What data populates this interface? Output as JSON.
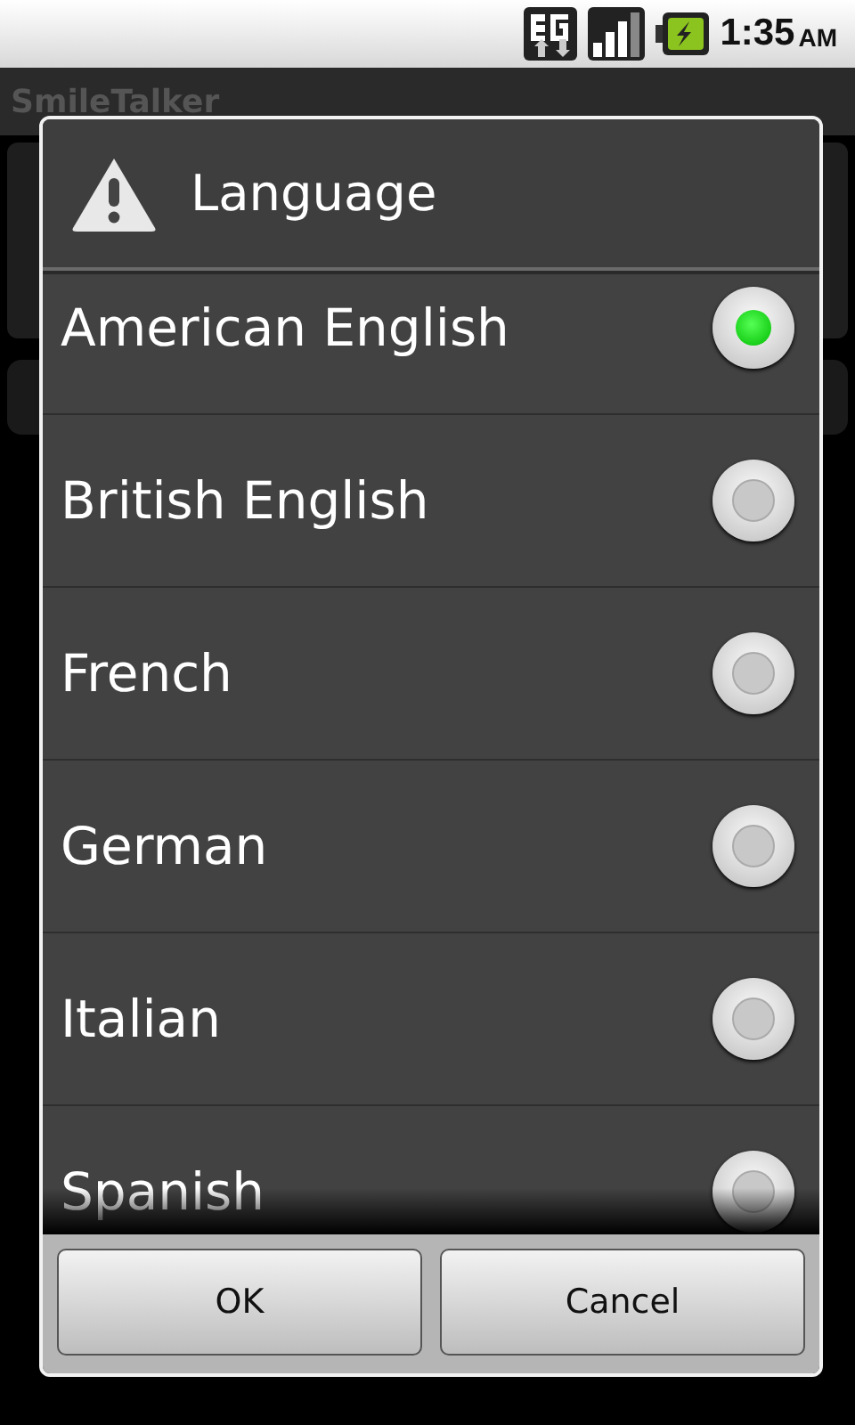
{
  "status_bar": {
    "time": "1:35",
    "ampm": "AM"
  },
  "app": {
    "title": "SmileTalker"
  },
  "dialog": {
    "title": "Language",
    "options": [
      {
        "label": "American English",
        "selected": true
      },
      {
        "label": "British English",
        "selected": false
      },
      {
        "label": "French",
        "selected": false
      },
      {
        "label": "German",
        "selected": false
      },
      {
        "label": "Italian",
        "selected": false
      },
      {
        "label": "Spanish",
        "selected": false
      }
    ],
    "buttons": [
      "OK",
      "Cancel"
    ]
  }
}
